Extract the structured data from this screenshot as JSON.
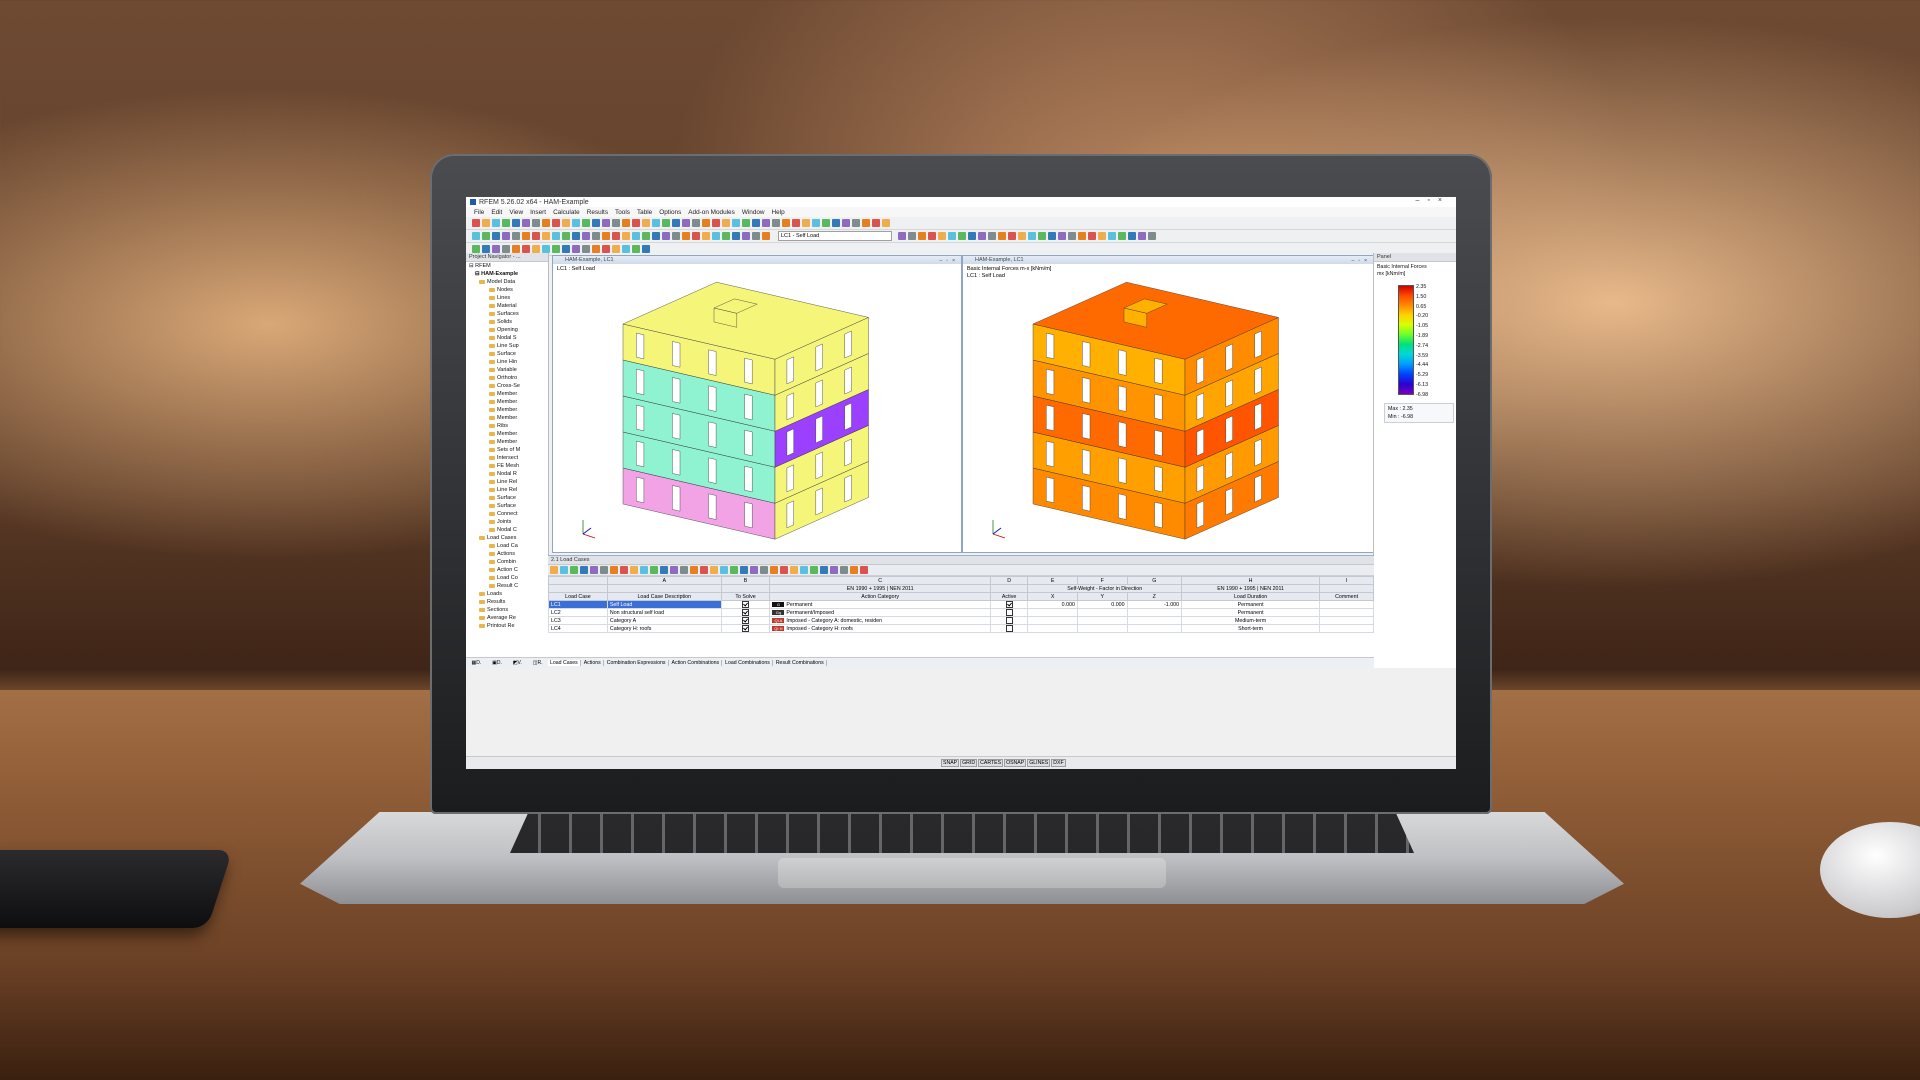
{
  "app": {
    "title": "RFEM 5.26.02 x64 - HAM-Example",
    "menu": [
      "File",
      "Edit",
      "View",
      "Insert",
      "Calculate",
      "Results",
      "Tools",
      "Table",
      "Options",
      "Add-on Modules",
      "Window",
      "Help"
    ],
    "load_case_select": "LC1 - Self Load"
  },
  "navigator": {
    "title": "Project Navigator - ...",
    "root": "RFEM",
    "project": "HAM-Example",
    "items": [
      "Model Data",
      "Nodes",
      "Lines",
      "Material",
      "Surfaces",
      "Solids",
      "Opening",
      "Nodal S",
      "Line Sup",
      "Surface",
      "Line Hin",
      "Variable",
      "Orthotro",
      "Cross-Se",
      "Member",
      "Member",
      "Member",
      "Member",
      "Ribs",
      "Member",
      "Member",
      "Sets of M",
      "Intersect",
      "FE Mesh",
      "Nodal R",
      "Line Rel",
      "Line Rel",
      "Surface",
      "Surface",
      "Connect",
      "Joints",
      "Nodal C",
      "Load Cases",
      "Load Ca",
      "Actions",
      "Combin",
      "Action C",
      "Load Co",
      "Result C",
      "Loads",
      "Results",
      "Sections",
      "Average Re",
      "Printout Re"
    ]
  },
  "views": [
    {
      "title": "HAM-Example, LC1",
      "info": [
        "LC1 : Self Load"
      ]
    },
    {
      "title": "HAM-Example, LC1",
      "info": [
        "Basic Internal Forces m-x [kNm/m]",
        "LC1 : Self Load"
      ]
    }
  ],
  "panel": {
    "title": "Panel",
    "legend_title": "Basic Internal Forces",
    "legend_unit": "mx [kNm/m]",
    "legend_values": [
      "2.35",
      "1.50",
      "0.65",
      "-0.20",
      "-1.05",
      "-1.89",
      "-2.74",
      "-3.59",
      "-4.44",
      "-5.29",
      "-6.13",
      "-6.98"
    ],
    "max_label": "Max :",
    "max": "2.35",
    "min_label": "Min :",
    "min": "-6.98"
  },
  "table": {
    "title": "2.1 Load Cases",
    "col_letters": [
      "A",
      "B",
      "C",
      "D",
      "E",
      "F",
      "G",
      "H",
      "I"
    ],
    "group_headers": [
      "EN 1990 + 1995 | NEN 2011",
      "Self-Weight - Factor in Direction",
      "EN 1990 + 1995 | NEN 2011"
    ],
    "headers": [
      "Load Case",
      "Load Case Description",
      "To Solve",
      "Action Category",
      "Active",
      "X",
      "Y",
      "Z",
      "Load Duration",
      "Comment"
    ],
    "rows": [
      {
        "id": "LC1",
        "desc": "Self Load",
        "cat_code": "G",
        "cat": "Permanent",
        "active": true,
        "x": "0.000",
        "y": "0.000",
        "z": "-1.000",
        "duration": "Permanent",
        "color": "#111111"
      },
      {
        "id": "LC2",
        "desc": "Non structural self load",
        "cat_code": "Gq",
        "cat": "Permanent/Imposed",
        "active": false,
        "x": "",
        "y": "",
        "z": "",
        "duration": "Permanent",
        "color": "#333333"
      },
      {
        "id": "LC3",
        "desc": "Category A",
        "cat_code": "QI A",
        "cat": "Imposed - Category A: domestic, residen",
        "active": false,
        "x": "",
        "y": "",
        "z": "",
        "duration": "Medium-term",
        "color": "#c0392b"
      },
      {
        "id": "LC4",
        "desc": "Category H: roofs",
        "cat_code": "QI H",
        "cat": "Imposed - Category H: roofs",
        "active": false,
        "x": "",
        "y": "",
        "z": "",
        "duration": "Short-term",
        "color": "#c0392b"
      }
    ],
    "tabs": [
      "Load Cases",
      "Actions",
      "Combination Expressions",
      "Action Combinations",
      "Load Combinations",
      "Result Combinations"
    ]
  },
  "statusbar": {
    "toggles": [
      "SNAP",
      "GRID",
      "CARTES",
      "OSNAP",
      "GLINES",
      "DXF"
    ]
  }
}
